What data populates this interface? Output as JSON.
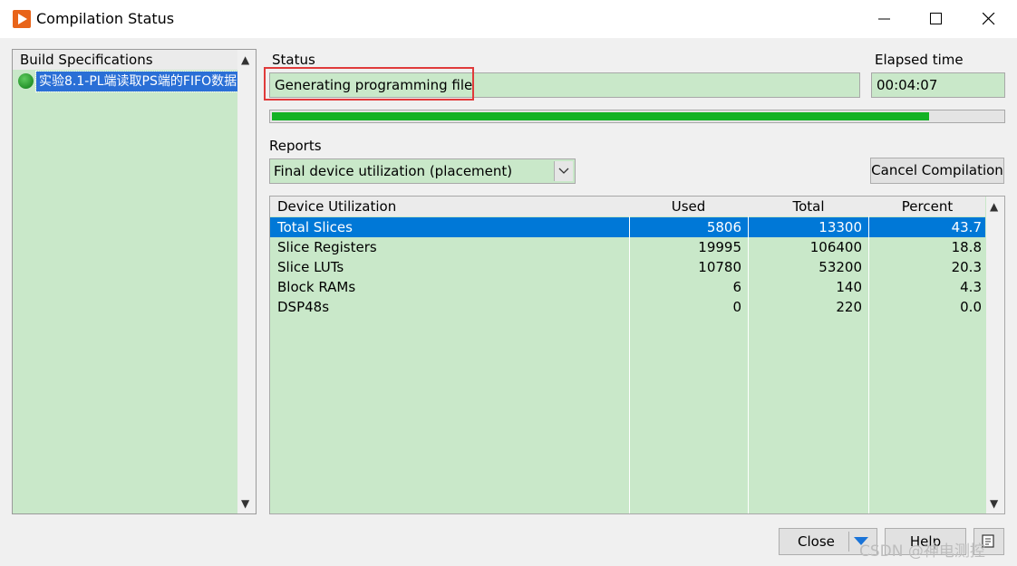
{
  "window": {
    "title": "Compilation Status"
  },
  "build_specs": {
    "header": "Build Specifications",
    "items": [
      {
        "label": "实验8.1-PL端读取PS端的FIFO数据"
      }
    ]
  },
  "status": {
    "label": "Status",
    "value": "Generating programming file"
  },
  "elapsed": {
    "label": "Elapsed time",
    "value": "00:04:07"
  },
  "progress": {
    "percent": 90
  },
  "reports": {
    "label": "Reports",
    "selected": "Final device utilization (placement)"
  },
  "buttons": {
    "cancel": "Cancel Compilation",
    "close": "Close",
    "help": "Help"
  },
  "table": {
    "columns": [
      "Device Utilization",
      "Used",
      "Total",
      "Percent"
    ],
    "rows": [
      {
        "name": "Total Slices",
        "used": "5806",
        "total": "13300",
        "percent": "43.7"
      },
      {
        "name": "Slice Registers",
        "used": "19995",
        "total": "106400",
        "percent": "18.8"
      },
      {
        "name": "Slice LUTs",
        "used": "10780",
        "total": "53200",
        "percent": "20.3"
      },
      {
        "name": "Block RAMs",
        "used": "6",
        "total": "140",
        "percent": "4.3"
      },
      {
        "name": "DSP48s",
        "used": "0",
        "total": "220",
        "percent": "0.0"
      }
    ]
  },
  "watermark": "CSDN @神电测控",
  "icons": [
    "labview-app-icon",
    "minimize-icon",
    "maximize-icon",
    "close-icon",
    "chevron-up-icon",
    "chevron-down-icon",
    "dropdown-chevron-icon",
    "split-arrow-icon",
    "context-help-icon"
  ]
}
